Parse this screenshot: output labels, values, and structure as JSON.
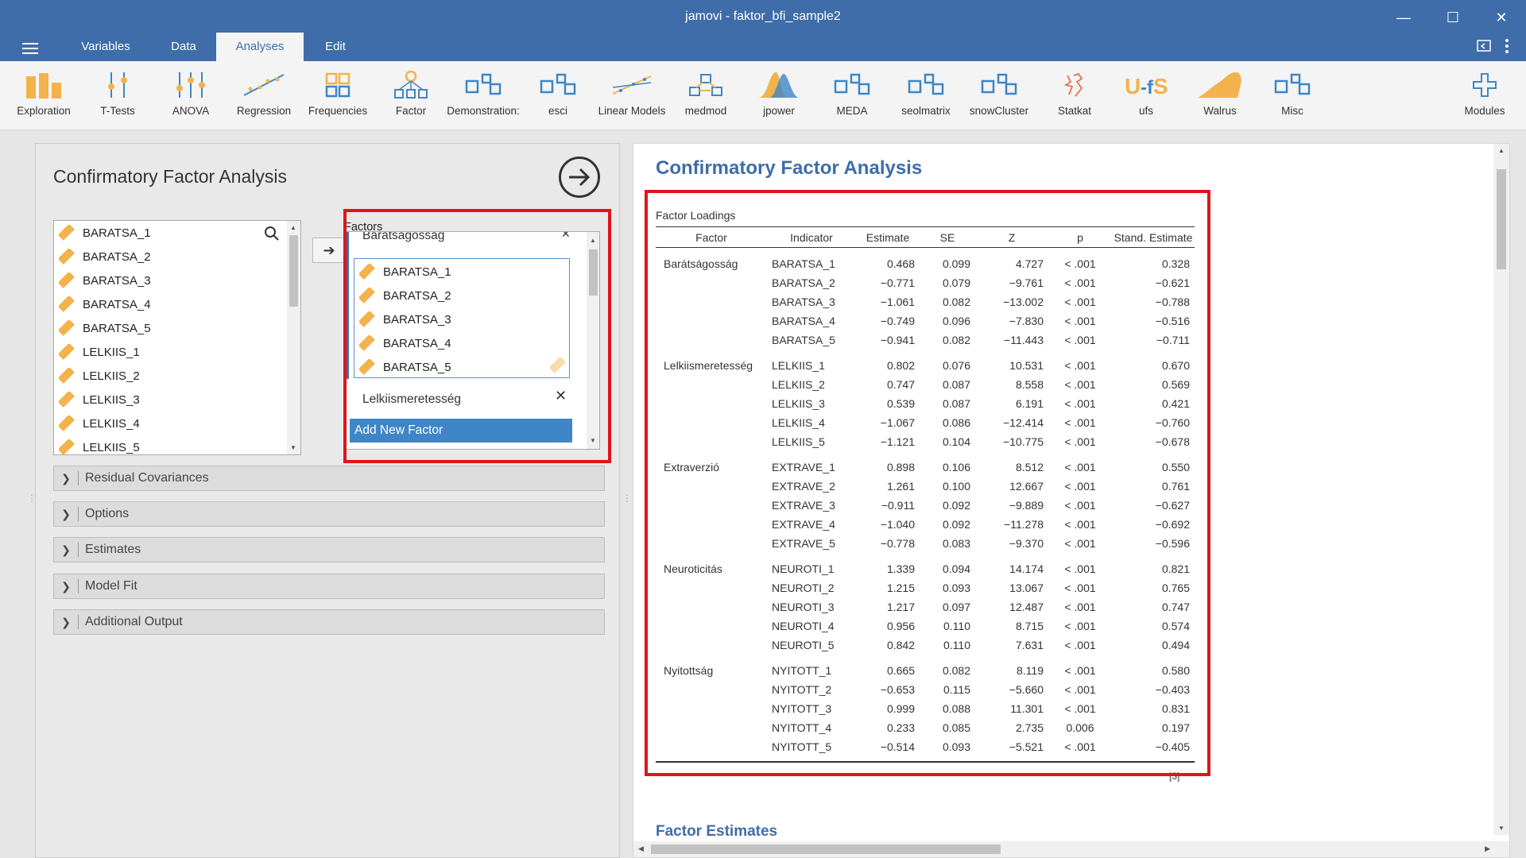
{
  "window": {
    "title": "jamovi - faktor_bfi_sample2",
    "minimize": "—",
    "maximize": "☐",
    "close": "✕"
  },
  "tabs": [
    {
      "label": "Variables"
    },
    {
      "label": "Data"
    },
    {
      "label": "Analyses",
      "active": true
    },
    {
      "label": "Edit"
    }
  ],
  "ribbon": [
    {
      "label": "Exploration",
      "icon": "exploration-icon"
    },
    {
      "label": "T-Tests",
      "icon": "t-tests-icon"
    },
    {
      "label": "ANOVA",
      "icon": "anova-icon"
    },
    {
      "label": "Regression",
      "icon": "regression-icon"
    },
    {
      "label": "Frequencies",
      "icon": "frequencies-icon"
    },
    {
      "label": "Factor",
      "icon": "factor-icon"
    },
    {
      "label": "Demonstration:",
      "icon": "module-icon"
    },
    {
      "label": "esci",
      "icon": "module-icon"
    },
    {
      "label": "Linear Models",
      "icon": "linear-models-icon"
    },
    {
      "label": "medmod",
      "icon": "medmod-icon"
    },
    {
      "label": "jpower",
      "icon": "jpower-icon"
    },
    {
      "label": "MEDA",
      "icon": "module-icon"
    },
    {
      "label": "seolmatrix",
      "icon": "module-icon"
    },
    {
      "label": "snowCluster",
      "icon": "module-icon"
    },
    {
      "label": "Statkat",
      "icon": "statkat-icon"
    },
    {
      "label": "ufs",
      "icon": "ufs-icon"
    },
    {
      "label": "Walrus",
      "icon": "walrus-icon"
    },
    {
      "label": "Misc",
      "icon": "module-icon"
    },
    {
      "label": "Modules",
      "icon": "plus-icon"
    }
  ],
  "options_panel": {
    "title": "Confirmatory Factor Analysis",
    "variables": [
      "BARATSA_1",
      "BARATSA_2",
      "BARATSA_3",
      "BARATSA_4",
      "BARATSA_5",
      "LELKIIS_1",
      "LELKIIS_2",
      "LELKIIS_3",
      "LELKIIS_4",
      "LELKIIS_5"
    ],
    "factors_label": "Factors",
    "factor1_name": "Barátságosság",
    "factor1_vars": [
      "BARATSA_1",
      "BARATSA_2",
      "BARATSA_3",
      "BARATSA_4",
      "BARATSA_5"
    ],
    "factor2_name": "Lelkiismeretesség",
    "add_factor_label": "Add New Factor",
    "sections": [
      "Residual Covariances",
      "Options",
      "Estimates",
      "Model Fit",
      "Additional Output"
    ]
  },
  "results": {
    "title": "Confirmatory Factor Analysis",
    "table_caption": "Factor Loadings",
    "columns": [
      "Factor",
      "Indicator",
      "Estimate",
      "SE",
      "Z",
      "p",
      "Stand. Estimate"
    ],
    "rows": [
      [
        "Barátságosság",
        "BARATSA_1",
        "0.468",
        "0.099",
        "4.727",
        "< .001",
        "0.328"
      ],
      [
        "",
        "BARATSA_2",
        "−0.771",
        "0.079",
        "−9.761",
        "< .001",
        "−0.621"
      ],
      [
        "",
        "BARATSA_3",
        "−1.061",
        "0.082",
        "−13.002",
        "< .001",
        "−0.788"
      ],
      [
        "",
        "BARATSA_4",
        "−0.749",
        "0.096",
        "−7.830",
        "< .001",
        "−0.516"
      ],
      [
        "",
        "BARATSA_5",
        "−0.941",
        "0.082",
        "−11.443",
        "< .001",
        "−0.711"
      ],
      [
        "Lelkiismeretesség",
        "LELKIIS_1",
        "0.802",
        "0.076",
        "10.531",
        "< .001",
        "0.670"
      ],
      [
        "",
        "LELKIIS_2",
        "0.747",
        "0.087",
        "8.558",
        "< .001",
        "0.569"
      ],
      [
        "",
        "LELKIIS_3",
        "0.539",
        "0.087",
        "6.191",
        "< .001",
        "0.421"
      ],
      [
        "",
        "LELKIIS_4",
        "−1.067",
        "0.086",
        "−12.414",
        "< .001",
        "−0.760"
      ],
      [
        "",
        "LELKIIS_5",
        "−1.121",
        "0.104",
        "−10.775",
        "< .001",
        "−0.678"
      ],
      [
        "Extraverzió",
        "EXTRAVE_1",
        "0.898",
        "0.106",
        "8.512",
        "< .001",
        "0.550"
      ],
      [
        "",
        "EXTRAVE_2",
        "1.261",
        "0.100",
        "12.667",
        "< .001",
        "0.761"
      ],
      [
        "",
        "EXTRAVE_3",
        "−0.911",
        "0.092",
        "−9.889",
        "< .001",
        "−0.627"
      ],
      [
        "",
        "EXTRAVE_4",
        "−1.040",
        "0.092",
        "−11.278",
        "< .001",
        "−0.692"
      ],
      [
        "",
        "EXTRAVE_5",
        "−0.778",
        "0.083",
        "−9.370",
        "< .001",
        "−0.596"
      ],
      [
        "Neuroticitás",
        "NEUROTI_1",
        "1.339",
        "0.094",
        "14.174",
        "< .001",
        "0.821"
      ],
      [
        "",
        "NEUROTI_2",
        "1.215",
        "0.093",
        "13.067",
        "< .001",
        "0.765"
      ],
      [
        "",
        "NEUROTI_3",
        "1.217",
        "0.097",
        "12.487",
        "< .001",
        "0.747"
      ],
      [
        "",
        "NEUROTI_4",
        "0.956",
        "0.110",
        "8.715",
        "< .001",
        "0.574"
      ],
      [
        "",
        "NEUROTI_5",
        "0.842",
        "0.110",
        "7.631",
        "< .001",
        "0.494"
      ],
      [
        "Nyitottság",
        "NYITOTT_1",
        "0.665",
        "0.082",
        "8.119",
        "< .001",
        "0.580"
      ],
      [
        "",
        "NYITOTT_2",
        "−0.653",
        "0.115",
        "−5.660",
        "< .001",
        "−0.403"
      ],
      [
        "",
        "NYITOTT_3",
        "0.999",
        "0.088",
        "11.301",
        "< .001",
        "0.831"
      ],
      [
        "",
        "NYITOTT_4",
        "0.233",
        "0.085",
        "2.735",
        "0.006",
        "0.197"
      ],
      [
        "",
        "NYITOTT_5",
        "−0.514",
        "0.093",
        "−5.521",
        "< .001",
        "−0.405"
      ]
    ],
    "footnote_ref": "[3]",
    "next_section": "Factor Estimates"
  },
  "colors": {
    "brand": "#3e6da9",
    "highlight": "#e2141b",
    "ruler": "#f2b24c"
  }
}
